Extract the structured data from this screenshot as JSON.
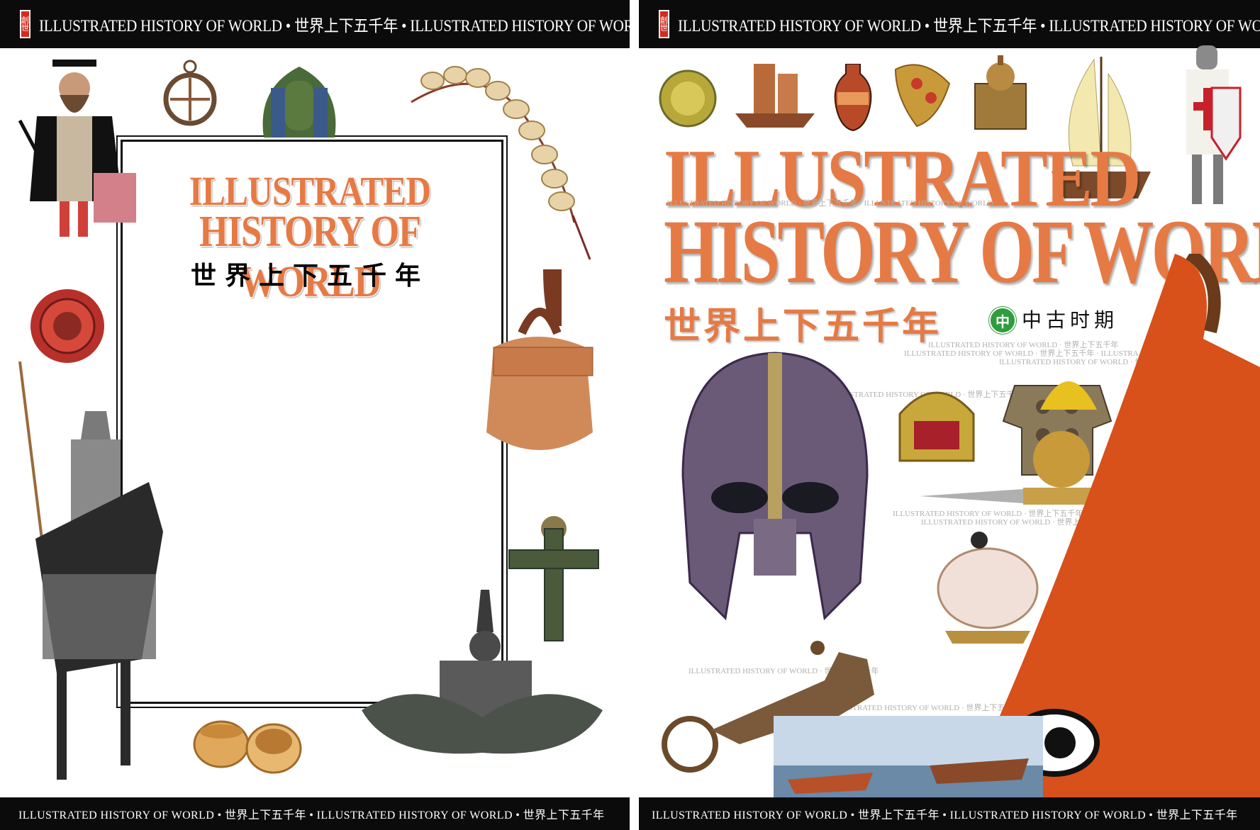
{
  "header_text": "ILLUSTRATED HISTORY OF WORLD • 世界上下五千年 • ILLUSTRATED HISTORY OF WORLD",
  "footer_text": "ILLUSTRATED HISTORY OF WORLD • 世界上下五千年 • ILLUSTRATED HISTORY OF WORLD • 世界上下五千年",
  "logo_text": "創世",
  "left_page": {
    "title_line1": "ILLUSTRATED",
    "title_line2": "HISTORY OF WORLD",
    "title_cn": "世界上下五千年"
  },
  "right_page": {
    "title_line1": "ILLUSTRATED",
    "title_line2": "HISTORY OF WORLD",
    "title_cn": "世界上下五千年",
    "volume_badge": "中",
    "volume_subtitle": "中古时期",
    "watermarks": [
      "ILLUSTRATED HISTORY OF WORLD · 世界上下五千年 · ILLUSTRATED HISTORY OF WORLD",
      "ILLUSTRATED HISTORY OF WORLD · 世界上下五千年",
      "ILLUSTRATED HISTORY OF WORLD · 世界上下五千年 · ILLUSTRA",
      "ILLUSTRATED HISTORY OF WORLD · 世界上下五千年",
      "ILLUSTRATED HISTORY OF WORLD · 世界上下五千年",
      "ILLUSTRATED HISTORY OF WORLD · 世界上下五千年 · ILLUST",
      "ILLUSTRATED HISTORY OF WORLD · 世界上下五千年",
      "ILLUSTRATED HISTORY OF WORLD · 世界上下五千年",
      "ILLUSTRATED HISTORY OF WORLD · 世界上下五千年"
    ]
  },
  "colors": {
    "title_orange": "#e57a45",
    "bar_black": "#0b0b0b",
    "badge_green": "#2e9d3e"
  }
}
